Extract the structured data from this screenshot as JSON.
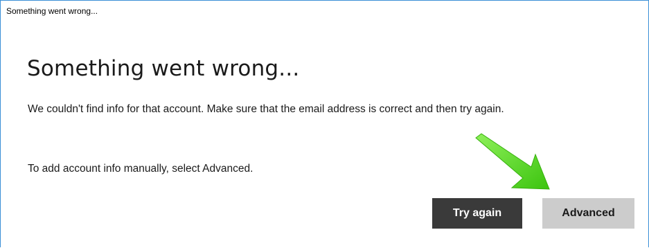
{
  "window": {
    "title": "Something went wrong..."
  },
  "dialog": {
    "heading": "Something went wrong...",
    "message": "We couldn't find info for that account. Make sure that the email address is correct and then try again.",
    "manual_message": "To add account info manually, select Advanced."
  },
  "buttons": {
    "try_again_label": "Try again",
    "advanced_label": "Advanced"
  },
  "annotation": {
    "arrow_color": "#5ad61a",
    "arrow_icon": "green-arrow-icon"
  },
  "colors": {
    "window_border": "#3a8fd6",
    "primary_button_bg": "#3a3a3a",
    "secondary_button_bg": "#cccccc"
  }
}
